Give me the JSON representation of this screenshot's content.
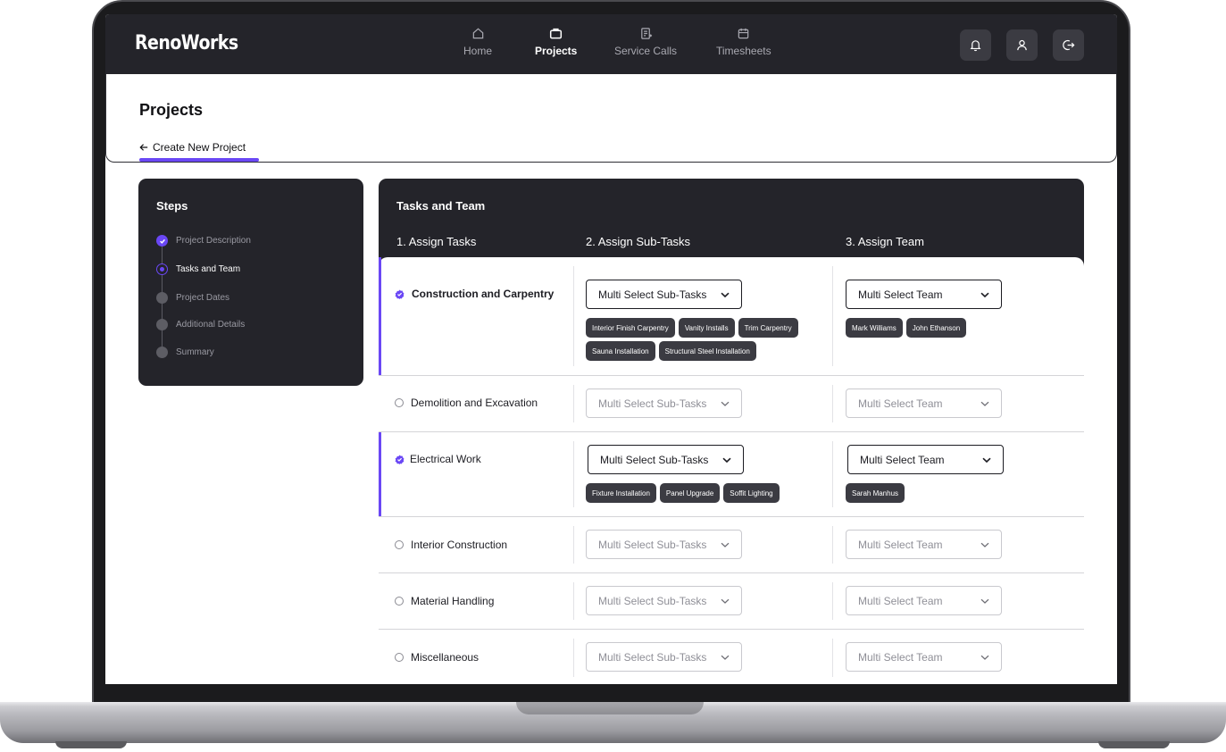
{
  "app": {
    "logo": "RenoWorks"
  },
  "nav": {
    "items": [
      {
        "label": "Home",
        "icon": "home-icon"
      },
      {
        "label": "Projects",
        "icon": "briefcase-icon",
        "active": true
      },
      {
        "label": "Service Calls",
        "icon": "clipboard-icon"
      },
      {
        "label": "Timesheets",
        "icon": "calendar-icon"
      }
    ],
    "actions": [
      "bell-icon",
      "user-icon",
      "logout-icon"
    ]
  },
  "page": {
    "title": "Projects",
    "back_label": "Create New Project"
  },
  "steps": {
    "title": "Steps",
    "items": [
      {
        "label": "Project Description",
        "status": "done"
      },
      {
        "label": "Tasks and Team",
        "status": "current"
      },
      {
        "label": "Project Dates",
        "status": "pending"
      },
      {
        "label": "Additional Details",
        "status": "pending"
      },
      {
        "label": "Summary",
        "status": "pending"
      }
    ]
  },
  "tasks": {
    "title": "Tasks and Team",
    "col_headers": [
      "1. Assign Tasks",
      "2. Assign Sub-Tasks",
      "3. Assign Team"
    ],
    "subtask_placeholder": "Multi Select Sub-Tasks",
    "team_placeholder": "Multi Select Team",
    "rows": [
      {
        "name": "Construction and Carpentry",
        "selected": true,
        "subtasks": [
          "Interior Finish Carpentry",
          "Vanity Installs",
          "Trim Carpentry",
          "Sauna Installation",
          "Structural Steel Installation"
        ],
        "team": [
          "Mark Williams",
          "John Ethanson"
        ]
      },
      {
        "name": "Demolition and Excavation",
        "selected": false,
        "subtasks": [],
        "team": []
      },
      {
        "name": "Electrical Work",
        "selected": true,
        "subtasks": [
          "Fixture Installation",
          "Panel Upgrade",
          "Soffit Lighting"
        ],
        "team": [
          "Sarah Manhus"
        ]
      },
      {
        "name": "Interior Construction",
        "selected": false,
        "subtasks": [],
        "team": []
      },
      {
        "name": "Material Handling",
        "selected": false,
        "subtasks": [],
        "team": []
      },
      {
        "name": "Miscellaneous",
        "selected": false,
        "subtasks": [],
        "team": []
      }
    ]
  },
  "colors": {
    "accent": "#6a47f5",
    "dark": "#24242a",
    "chip": "#3b3b42"
  }
}
